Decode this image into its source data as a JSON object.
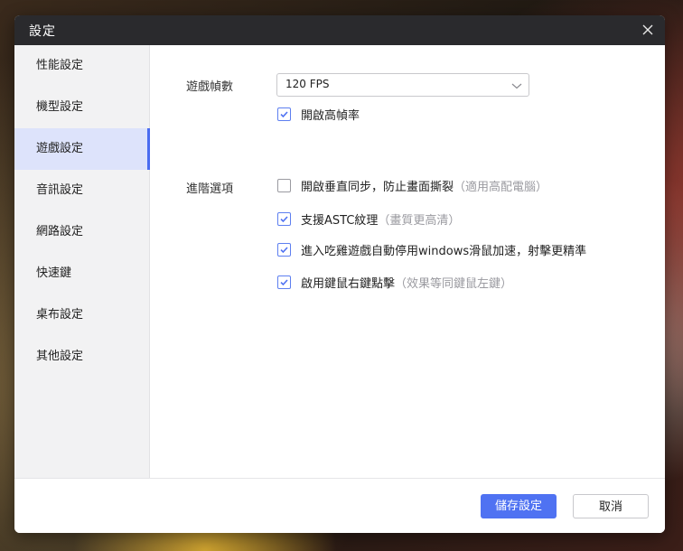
{
  "dialog": {
    "title": "設定"
  },
  "sidebar": {
    "items": [
      {
        "label": "性能設定"
      },
      {
        "label": "機型設定"
      },
      {
        "label": "遊戲設定",
        "active": true
      },
      {
        "label": "音訊設定"
      },
      {
        "label": "網路設定"
      },
      {
        "label": "快速鍵"
      },
      {
        "label": "桌布設定"
      },
      {
        "label": "其他設定"
      }
    ]
  },
  "game": {
    "fps_label": "遊戲幀數",
    "fps_value": "120 FPS",
    "high_fps": {
      "label": "開啟高幀率",
      "checked": true
    },
    "advanced_label": "進階選項",
    "options": [
      {
        "label": "開啟垂直同步，防止畫面撕裂",
        "hint": "（適用高配電腦）",
        "checked": false
      },
      {
        "label": "支援ASTC紋理",
        "hint": "（畫質更高清）",
        "checked": true
      },
      {
        "label": "進入吃雞遊戲自動停用windows滑鼠加速，射擊更精準",
        "hint": "",
        "checked": true
      },
      {
        "label": "啟用鍵鼠右鍵點擊",
        "hint": "（效果等同鍵鼠左鍵）",
        "checked": true
      }
    ]
  },
  "footer": {
    "save_label": "儲存設定",
    "cancel_label": "取消"
  },
  "colors": {
    "accent": "#4f72f2",
    "titlebar": "#2a2a2d",
    "sidebar_active": "#dde3fb"
  },
  "icons": {
    "close": "close-icon",
    "dropdown": "chevron-down-icon",
    "check": "checkmark-icon"
  }
}
